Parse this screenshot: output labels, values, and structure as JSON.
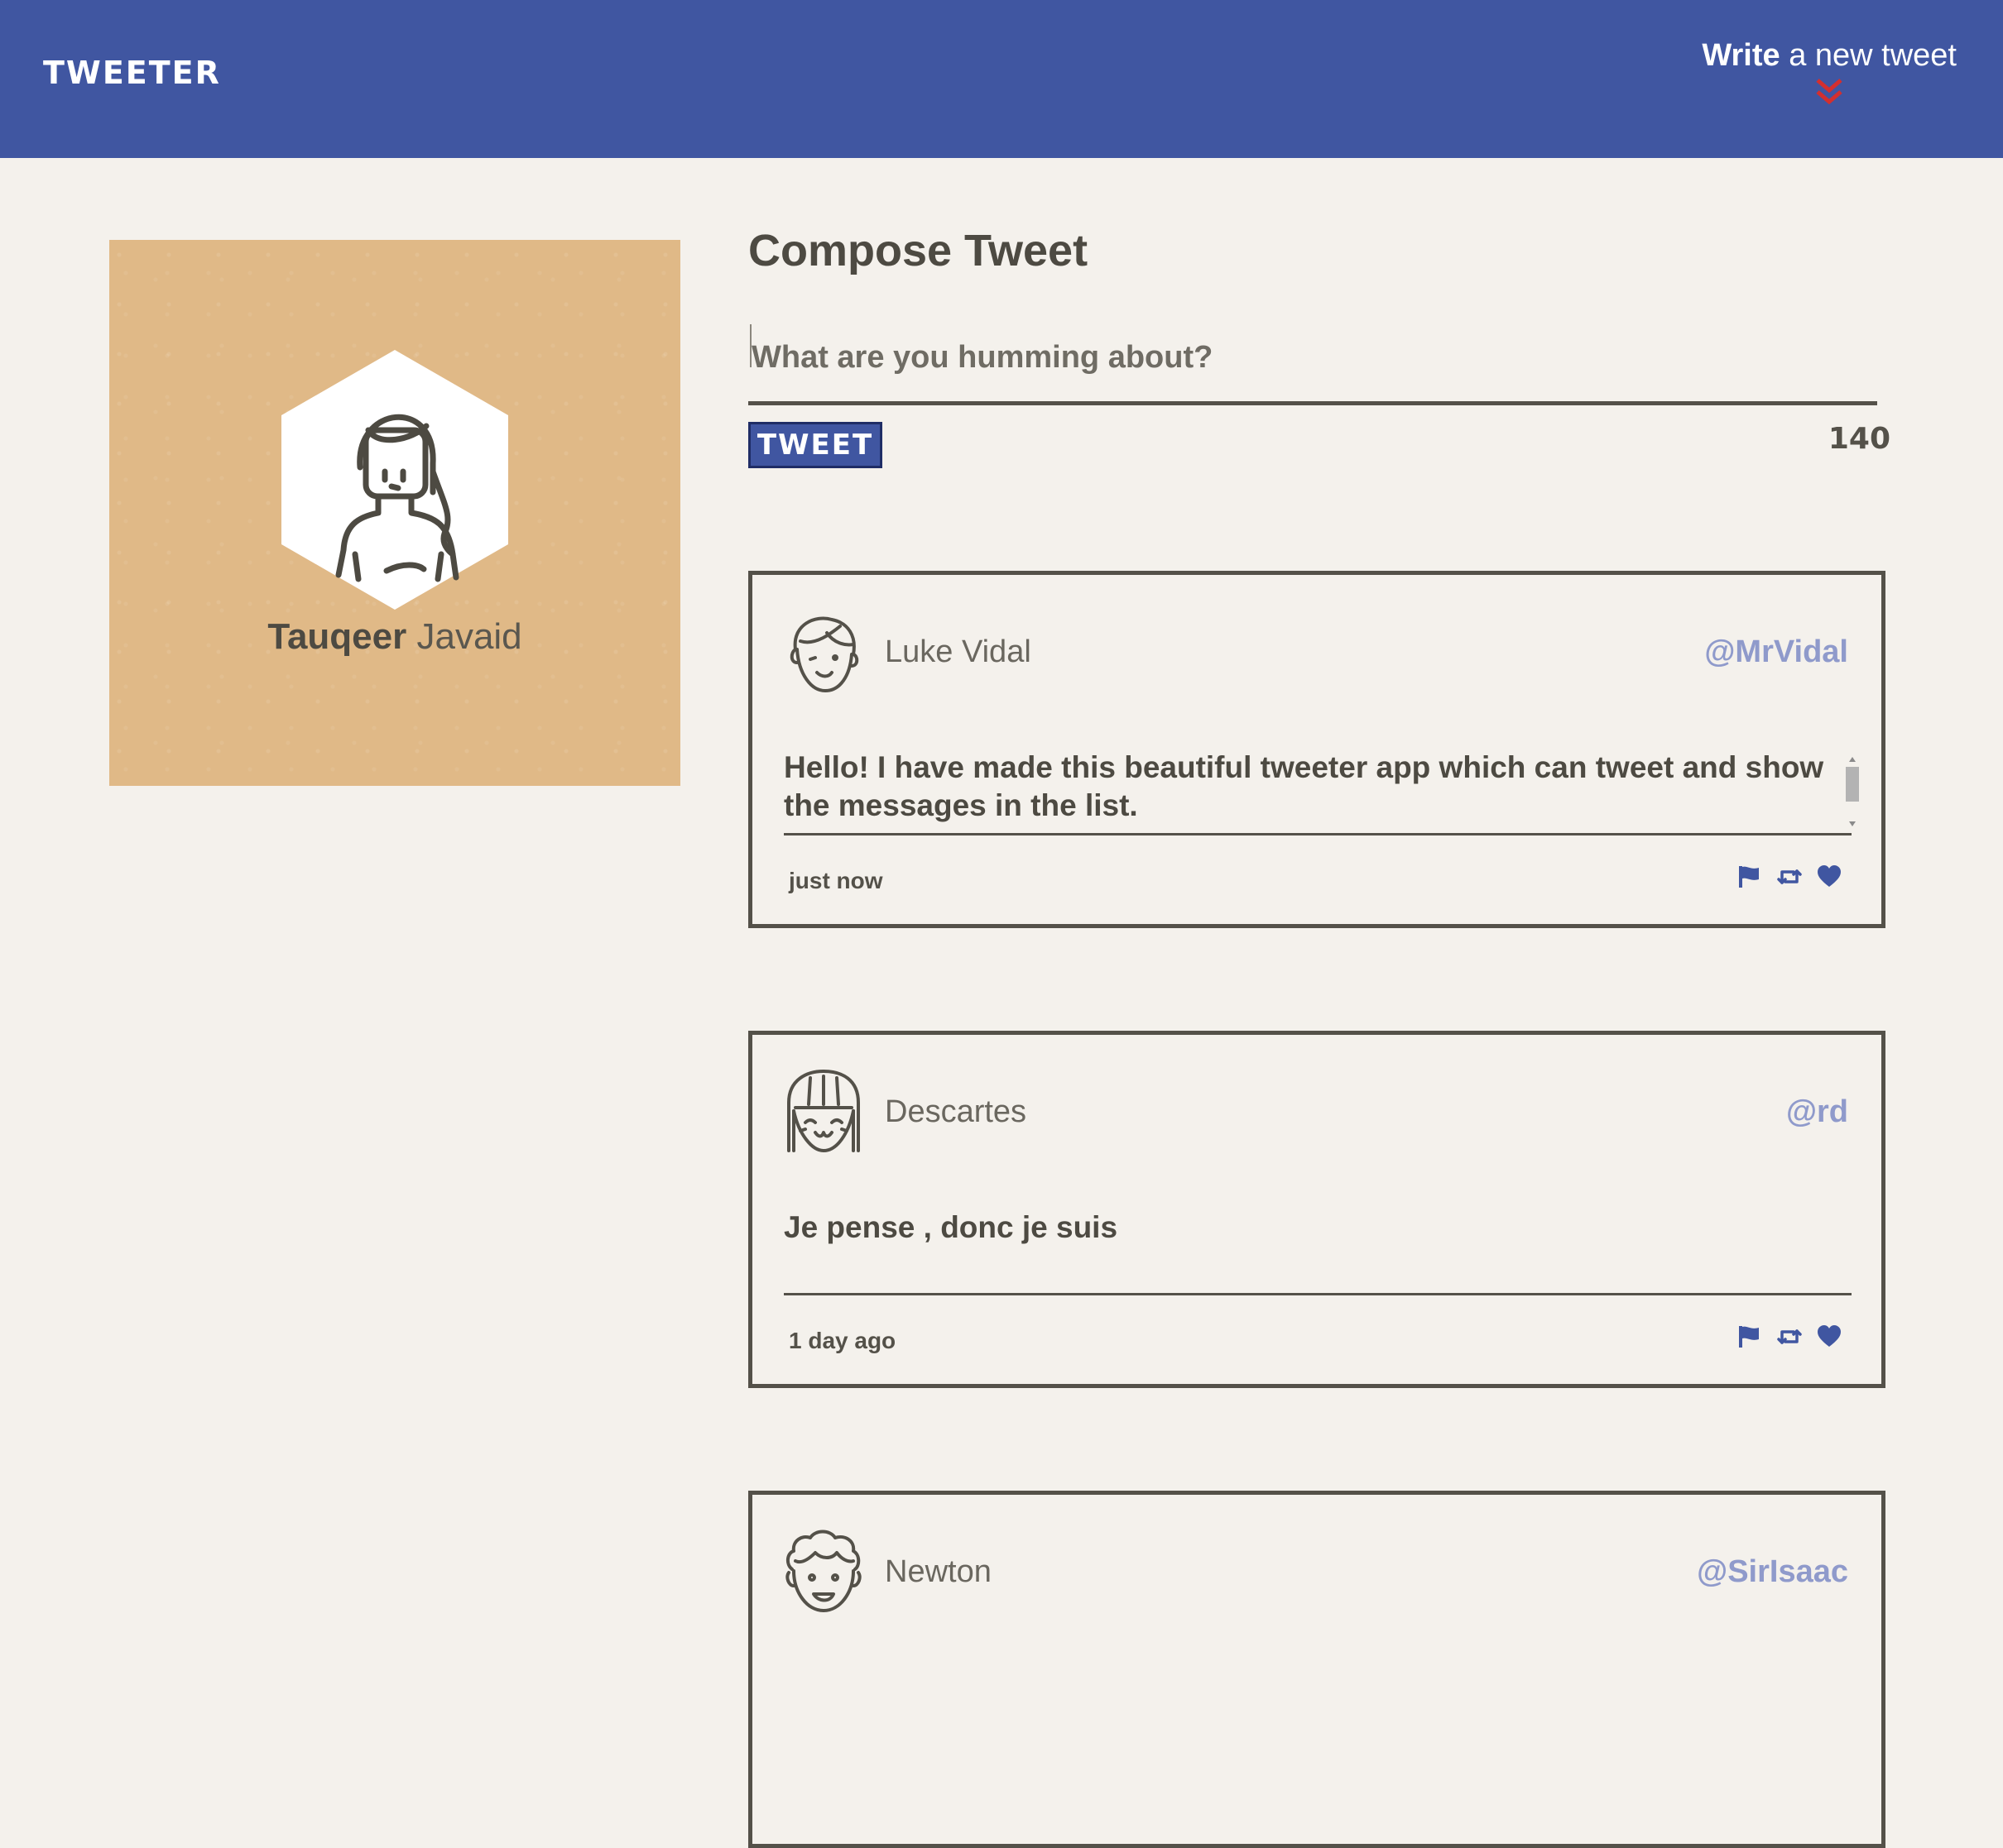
{
  "nav": {
    "brand": "TWEETER",
    "write_strong": "Write",
    "write_rest": "a new tweet",
    "chevron_icon": "double-chevron-down-icon"
  },
  "profile": {
    "first_name": "Tauqeer",
    "last_name": "Javaid",
    "avatar_icon": "woman-avatar-icon",
    "background_color": "#e0b987"
  },
  "compose": {
    "title": "Compose Tweet",
    "placeholder": "What are you humming about?",
    "button_label": "TWEET",
    "counter": "140"
  },
  "tweets": [
    {
      "name": "Luke Vidal",
      "handle": "@MrVidal",
      "text": "Hello! I have made this beautiful tweeter app which can tweet and show the messages in the list.",
      "time": "just now",
      "avatar_icon": "boy-face-icon"
    },
    {
      "name": "Descartes",
      "handle": "@rd",
      "text": "Je pense , donc je suis",
      "time": "1 day ago",
      "avatar_icon": "girl-bangs-face-icon"
    },
    {
      "name": "Newton",
      "handle": "@SirIsaac",
      "avatar_icon": "curly-hair-face-icon"
    }
  ],
  "colors": {
    "primary": "#4056a1",
    "background": "#f4f1ec",
    "text": "#545149",
    "handle": "#8f9acb",
    "accent_red": "#d32f2f"
  }
}
